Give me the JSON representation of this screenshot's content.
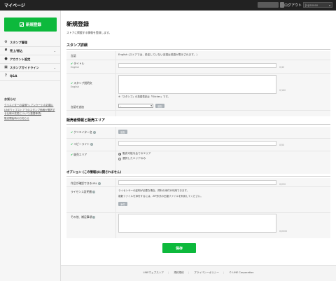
{
  "header": {
    "title": "マイページ",
    "logout": "ログアウト",
    "language": "Japanese"
  },
  "sidebar": {
    "new_button": "新規登録",
    "items": [
      {
        "label": "スタンプ管理",
        "icon": "gear-icon"
      },
      {
        "label": "売上/振込",
        "icon": "money-icon",
        "expandable": true
      },
      {
        "label": "アカウント設定",
        "icon": "person-icon"
      },
      {
        "label": "スタンプガイドライン",
        "icon": "book-icon",
        "expandable": true
      },
      {
        "label": "Q&A",
        "icon": "question-icon"
      }
    ],
    "notice": {
      "heading": "お知らせ",
      "links": [
        "クリエイターの皆様へ: アンケートのお願い",
        "LINEウェブストアでのスタンプ価格が選択する仕様の変更について(重要事項)",
        "販売開始時のお知らせ"
      ]
    }
  },
  "main": {
    "title": "新規登録",
    "description": "ストアに掲載する情報を登録します。",
    "stamp_section": {
      "heading": "スタンプ詳細",
      "language_label": "言語",
      "language_value": "English (ストアでは、設定していない言語は英語が表示されます。)",
      "title_label": "タイトル",
      "title_sub": "English",
      "title_counter": "0/40",
      "desc_label": "スタンプ説明文",
      "desc_sub": "English",
      "desc_counter": "0/160",
      "desc_note": "※「スタンプ」の英語表記は「Sticker」です。",
      "add_lang_label": "言語を追加",
      "add_lang_select": "-",
      "add_lang_button": "追加"
    },
    "sales_section": {
      "heading": "販売者情報と販売エリア",
      "creator_label": "クリエイター名",
      "creator_button": "追加",
      "copyright_label": "コピーライト",
      "copyright_counter": "0/50",
      "area_label": "販売エリア",
      "area_options": [
        "販売可能な全てのエリア",
        "選択したエリアのみ"
      ],
      "area_selected": 0
    },
    "option_section": {
      "heading": "オプション (この情報は公開されません)",
      "url_label": "作品が確認できるURL",
      "url_counter": "0/250",
      "license_label": "ライセンス証明書",
      "license_text1": "ライセンサーの証明が必要な場合、資料の添付が利用できます。",
      "license_text2": "複数ファイルを添付するには、ZIP形式の圧縮ファイルを利用してください。",
      "license_button": "添付",
      "memo_label": "その他、補足事項",
      "memo_counter": "0/2000"
    },
    "save_button": "保存"
  },
  "footer": {
    "links": [
      "LINEウェブストア",
      "規約規約",
      "プライバシーポリシー",
      "© LINE Corporation"
    ]
  }
}
